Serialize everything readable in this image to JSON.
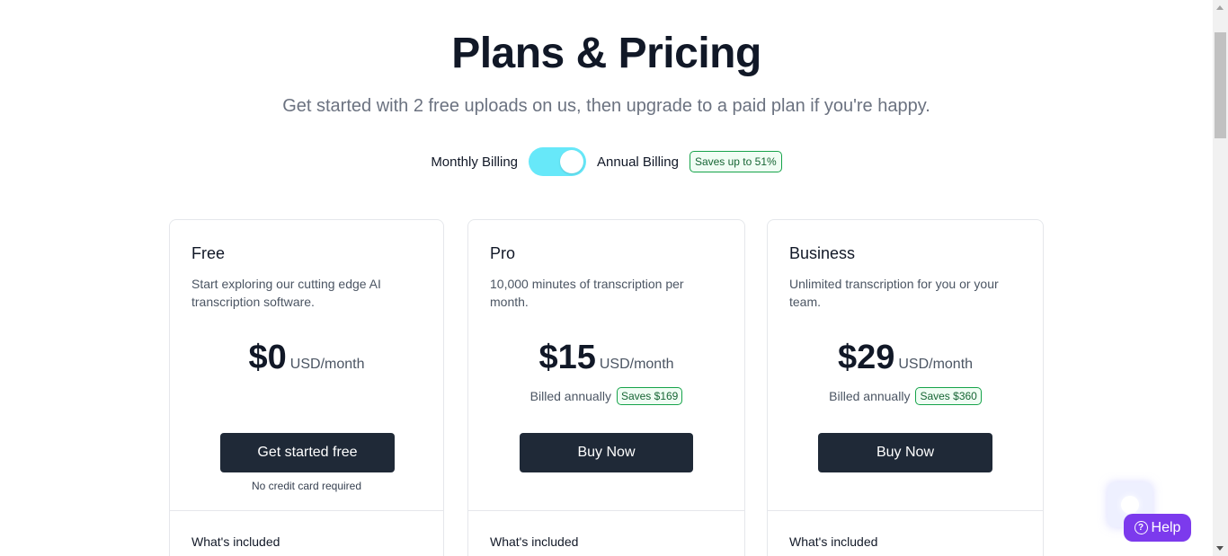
{
  "header": {
    "title": "Plans & Pricing",
    "subtitle": "Get started with 2 free uploads on us, then upgrade to a paid plan if you're happy."
  },
  "billing": {
    "monthly_label": "Monthly Billing",
    "annual_label": "Annual Billing",
    "savings_badge": "Saves up to 51%",
    "annual_selected": true,
    "toggle_color": "#67e8f9"
  },
  "plans": [
    {
      "name": "Free",
      "description": "Start exploring our cutting edge AI transcription software.",
      "price": "$0",
      "unit": "USD/month",
      "billed": "",
      "savings": "",
      "cta": "Get started free",
      "note": "No credit card required",
      "included": "What's included"
    },
    {
      "name": "Pro",
      "description": "10,000 minutes of transcription per month.",
      "price": "$15",
      "unit": "USD/month",
      "billed": "Billed annually",
      "savings": "Saves $169",
      "cta": "Buy Now",
      "note": "",
      "included": "What's included"
    },
    {
      "name": "Business",
      "description": "Unlimited transcription for you or your team.",
      "price": "$29",
      "unit": "USD/month",
      "billed": "Billed annually",
      "savings": "Saves $360",
      "cta": "Buy Now",
      "note": "",
      "included": "What's included"
    }
  ],
  "help": {
    "label": "Help",
    "icon": "question-circle-icon",
    "color": "#7c3aed"
  },
  "colors": {
    "button_dark": "#1f2937",
    "badge_green": "#16a34a"
  }
}
